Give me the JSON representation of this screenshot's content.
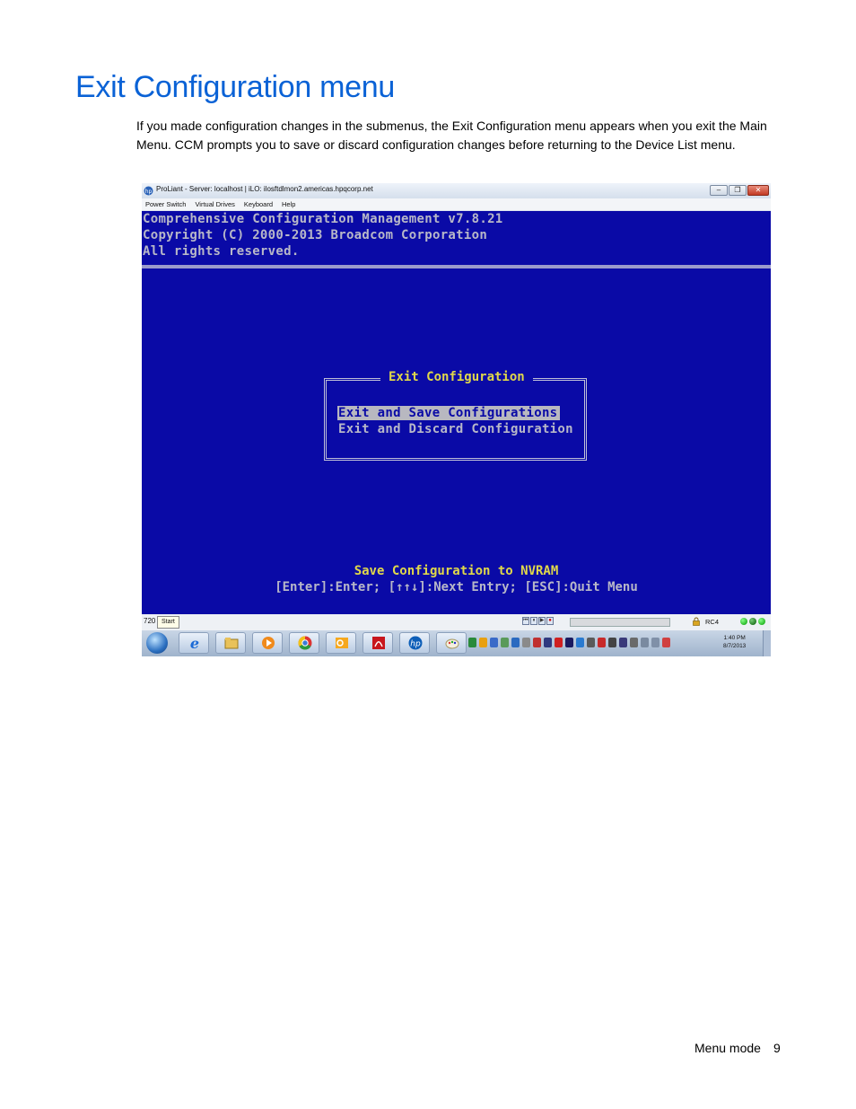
{
  "page": {
    "title": "Exit Configuration menu",
    "intro": "If you made configuration changes in the submenus, the Exit Configuration menu appears when you exit the Main Menu. CCM prompts you to save or discard configuration changes before returning to the Device List menu.",
    "footer_section": "Menu mode",
    "footer_page": "9"
  },
  "window": {
    "title": "ProLiant - Server: localhost | iLO: ilosftdlmon2.americas.hpqcorp.net",
    "menu": [
      "Power Switch",
      "Virtual Drives",
      "Keyboard",
      "Help"
    ],
    "controls": {
      "minimize": "–",
      "restore": "❐",
      "close": "✕"
    }
  },
  "console": {
    "header_lines": [
      "Comprehensive Configuration Management v7.8.21",
      "Copyright (C) 2000-2013 Broadcom Corporation",
      "All rights reserved."
    ],
    "dialog_title": "Exit Configuration",
    "options": [
      "Exit and Save Configurations",
      "Exit and Discard Configuration"
    ],
    "selected_index": 0,
    "status_line": "Save Configuration to NVRAM",
    "help_line": "[Enter]:Enter; [↑↑↓]:Next Entry; [ESC]:Quit Menu"
  },
  "statusbar": {
    "resolution": "720",
    "start_tooltip": "Start",
    "play_controls": [
      "⏮",
      "⏸",
      "▶",
      "●"
    ],
    "connection": "RC4"
  },
  "taskbar": {
    "clock_time": "1:40 PM",
    "clock_date": "8/7/2013"
  },
  "colors": {
    "title_blue": "#0a62d6",
    "console_bg": "#0a0aa6",
    "console_yellow": "#e0d84a",
    "console_gray": "#b8b8c8"
  }
}
